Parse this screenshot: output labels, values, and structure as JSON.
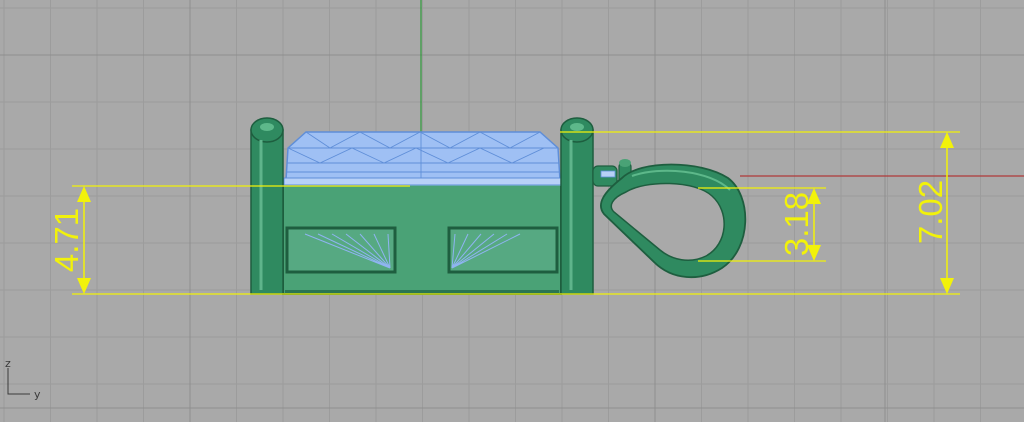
{
  "viewport": {
    "background": "#a9a9a9",
    "grid_color": "#9a9a9a",
    "grid_major_color": "#8f8f8f",
    "world_x_axis_color": "#b03a3a",
    "world_z_axis_color": "#2f9a3a"
  },
  "object": {
    "metal_color": "#2f8a60",
    "gem_color": "#8fb4f2"
  },
  "dimensions": {
    "color": "#f2f20a",
    "left_height": "4.71",
    "bail_height": "3.18",
    "total_height": "7.02"
  },
  "axis_gizmo": {
    "vertical_label": "z",
    "horizontal_label": "y"
  }
}
